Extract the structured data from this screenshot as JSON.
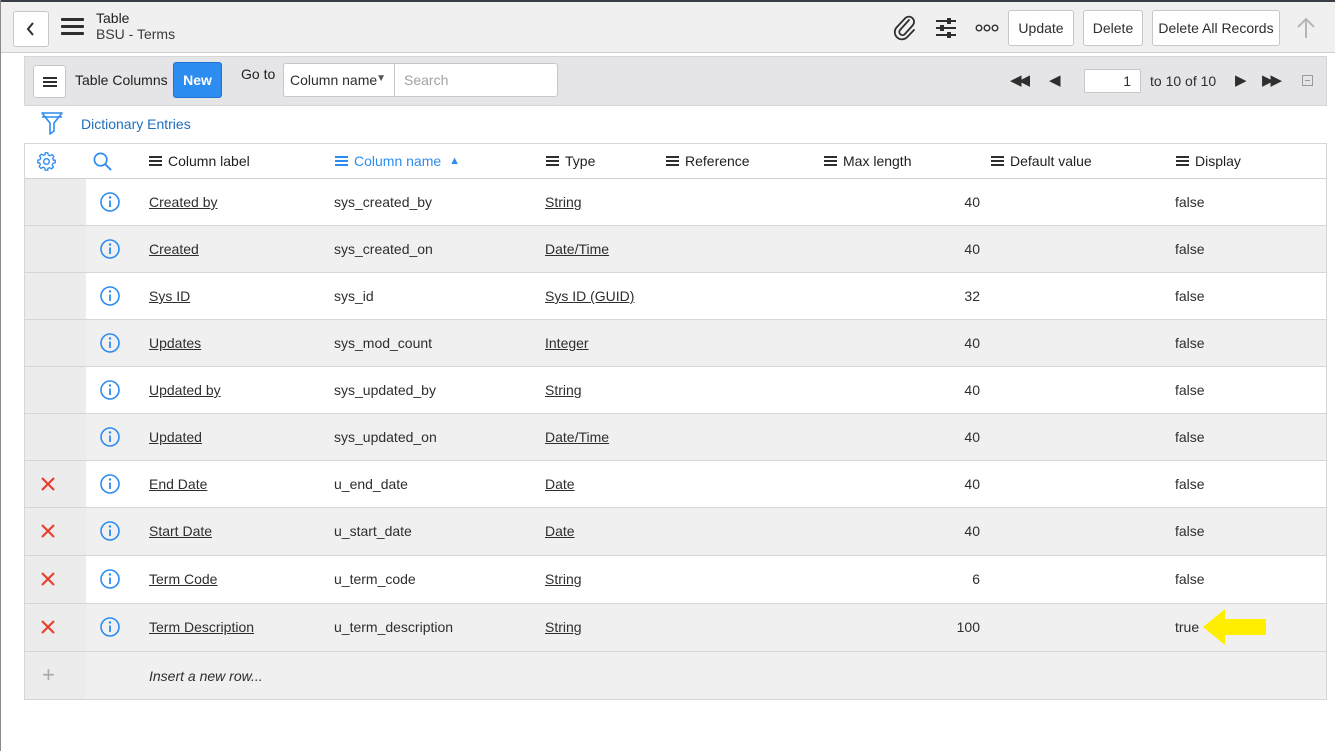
{
  "header": {
    "title": "Table",
    "subtitle": "BSU - Terms",
    "buttons": {
      "update": "Update",
      "delete": "Delete",
      "delete_all": "Delete All Records"
    },
    "icons": [
      "back-icon",
      "hamburger-icon",
      "attachment-icon",
      "settings-sliders-icon",
      "more-options-icon",
      "scroll-up-icon"
    ]
  },
  "related_list": {
    "title": "Table Columns",
    "new_label": "New",
    "goto_label": "Go to",
    "goto_selected": "Column name",
    "search_placeholder": "Search",
    "page_current": "1",
    "page_of": "to 10 of 10",
    "breadcrumb": "Dictionary Entries"
  },
  "table": {
    "columns": [
      "Column label",
      "Column name",
      "Type",
      "Reference",
      "Max length",
      "Default value",
      "Display"
    ],
    "sorted_column": "Column name",
    "rows": [
      {
        "label": "Created by",
        "name": "sys_created_by",
        "type": "String",
        "reference": "",
        "max_length": "40",
        "default": "",
        "display": "false",
        "deletable": false
      },
      {
        "label": "Created",
        "name": "sys_created_on",
        "type": "Date/Time",
        "reference": "",
        "max_length": "40",
        "default": "",
        "display": "false",
        "deletable": false
      },
      {
        "label": "Sys ID",
        "name": "sys_id",
        "type": "Sys ID (GUID)",
        "reference": "",
        "max_length": "32",
        "default": "",
        "display": "false",
        "deletable": false
      },
      {
        "label": "Updates",
        "name": "sys_mod_count",
        "type": "Integer",
        "reference": "",
        "max_length": "40",
        "default": "",
        "display": "false",
        "deletable": false
      },
      {
        "label": "Updated by",
        "name": "sys_updated_by",
        "type": "String",
        "reference": "",
        "max_length": "40",
        "default": "",
        "display": "false",
        "deletable": false
      },
      {
        "label": "Updated",
        "name": "sys_updated_on",
        "type": "Date/Time",
        "reference": "",
        "max_length": "40",
        "default": "",
        "display": "false",
        "deletable": false
      },
      {
        "label": "End Date",
        "name": "u_end_date",
        "type": "Date",
        "reference": "",
        "max_length": "40",
        "default": "",
        "display": "false",
        "deletable": true
      },
      {
        "label": "Start Date",
        "name": "u_start_date",
        "type": "Date",
        "reference": "",
        "max_length": "40",
        "default": "",
        "display": "false",
        "deletable": true
      },
      {
        "label": "Term Code",
        "name": "u_term_code",
        "type": "String",
        "reference": "",
        "max_length": "6",
        "default": "",
        "display": "false",
        "deletable": true
      },
      {
        "label": "Term Description",
        "name": "u_term_description",
        "type": "String",
        "reference": "",
        "max_length": "100",
        "default": "",
        "display": "true",
        "deletable": true
      }
    ],
    "insert_row_label": "Insert a new row..."
  },
  "colors": {
    "accent": "#2d8cf0",
    "delete_x": "#e8402f",
    "annotation_arrow": "#ffee00"
  }
}
